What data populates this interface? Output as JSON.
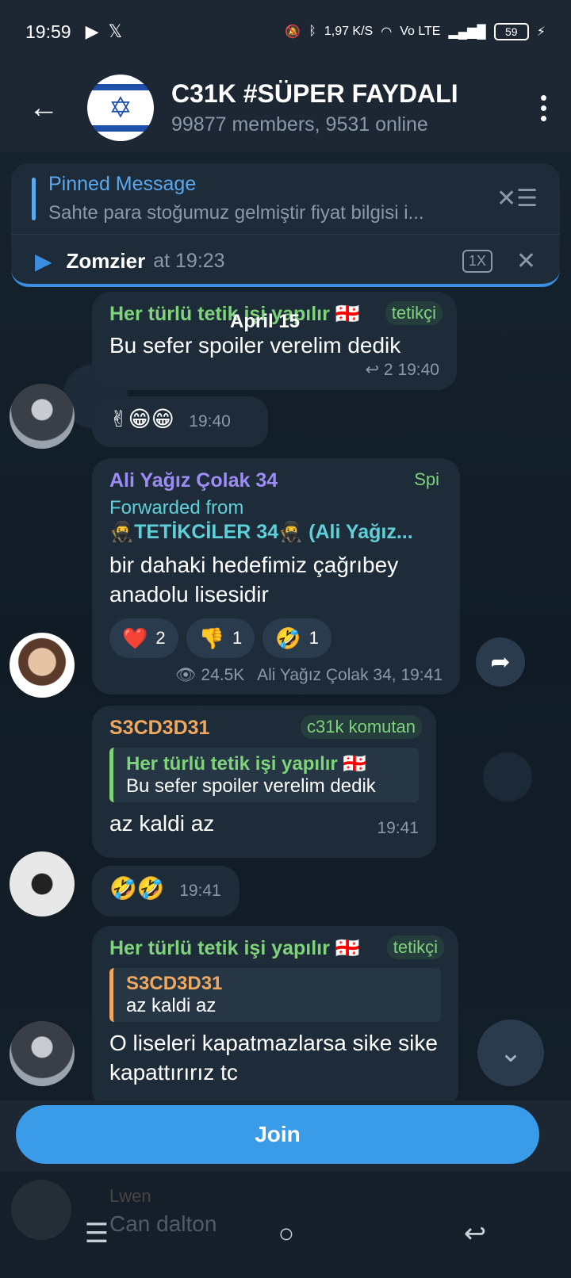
{
  "status_bar": {
    "time": "19:59",
    "net_speed": "1,97 K/S",
    "network": "Vo LTE",
    "battery": "59"
  },
  "header": {
    "title": "C31K #SÜPER FAYDALI",
    "subtitle": "99877 members, 9531 online",
    "avatar_icon": "star-of-david-flag"
  },
  "pinned": {
    "title": "Pinned Message",
    "text": "Sahte para stoğumuz gelmiştir fiyat bilgisi i..."
  },
  "voice_player": {
    "name": "Zomzier",
    "time": "at 19:23",
    "speed": "1X"
  },
  "date_badge": "April 15",
  "messages": [
    {
      "sender": "Her türlü tetik işi yapılır 🇬🇪",
      "role": "tetikçi",
      "text": "Bu sefer spoiler verelim dedik",
      "replies": "↩ 2",
      "time": "19:40"
    },
    {
      "text": "✌😁😁",
      "time": "19:40"
    },
    {
      "sender": "Ali Yağız Çolak 34",
      "role": "Spi",
      "forwarded_label": "Forwarded from",
      "forwarded_from": "🥷TETİKCİLER 34🥷 (Ali Yağız...",
      "text": "bir dahaki hedefimiz çağrıbey anadolu lisesidir",
      "reactions": [
        {
          "emoji": "❤️",
          "count": "2"
        },
        {
          "emoji": "👎",
          "count": "1"
        },
        {
          "emoji": "🤣",
          "count": "1"
        }
      ],
      "views": "24.5K",
      "signature": "Ali Yağız Çolak 34, 19:41"
    },
    {
      "sender": "S3CD3D31",
      "role": "c31k komutan",
      "quote_sender": "Her türlü tetik işi yapılır 🇬🇪",
      "quote_text": "Bu sefer spoiler verelim dedik",
      "text": "az kaldi az",
      "time": "19:41"
    },
    {
      "text": "🤣🤣",
      "time": "19:41"
    },
    {
      "sender": "Her türlü tetik işi yapılır 🇬🇪",
      "role": "tetikçi",
      "quote_sender": "S3CD3D31",
      "quote_text": "az kaldi az",
      "text": "O liseleri kapatmazlarsa sike sike kapattırırız tc"
    }
  ],
  "join_label": "Join",
  "preview": {
    "name": "Lwen",
    "text": "Can dalton"
  },
  "colors": {
    "accent": "#3a9be8",
    "green_name": "#7fd37a",
    "purple_name": "#9d8cf5",
    "orange_name": "#f0a860",
    "cyan_name": "#5fd0d8",
    "bubble": "#1e2c3a",
    "bg": "#15202b"
  }
}
